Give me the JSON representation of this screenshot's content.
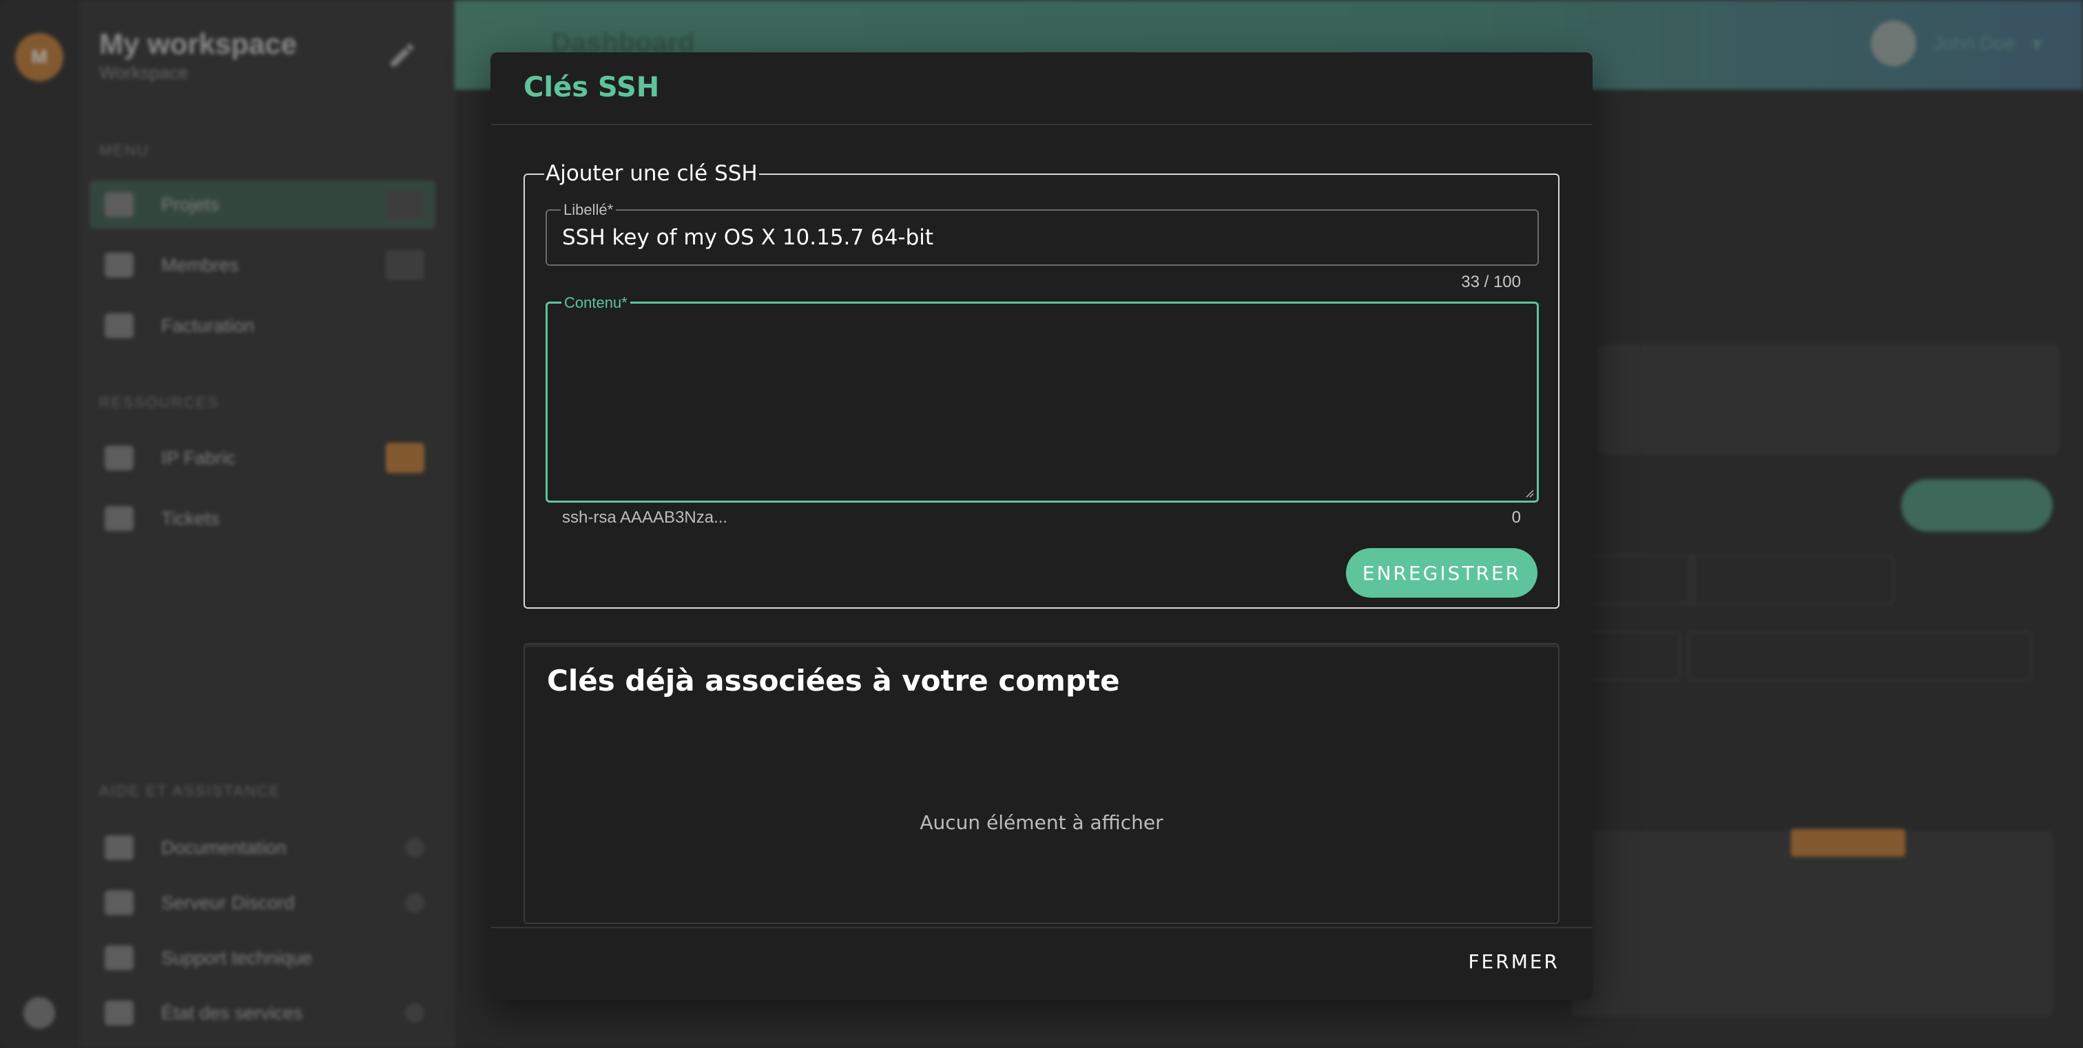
{
  "background": {
    "workspace": {
      "avatar_initials": "M",
      "title": "My workspace",
      "subtitle": "Workspace"
    },
    "sidebar": {
      "sections": [
        "MENU",
        "RESSOURCES",
        "AIDE ET ASSISTANCE"
      ],
      "items": [
        {
          "label": "Projets",
          "icon": "folder-icon"
        },
        {
          "label": "Membres",
          "icon": "team-icon"
        },
        {
          "label": "Facturation",
          "icon": "invoice-icon"
        },
        {
          "label": "IP Fabric",
          "icon": "globe-icon"
        },
        {
          "label": "Tickets",
          "icon": "list-icon"
        },
        {
          "label": "Documentation",
          "icon": "doc-icon"
        },
        {
          "label": "Serveur Discord",
          "icon": "chat-icon"
        },
        {
          "label": "Support technique",
          "icon": "support-icon"
        },
        {
          "label": "État des services",
          "icon": "status-icon"
        }
      ]
    },
    "topbar": {
      "title": "Dashboard",
      "user": "John Doe"
    }
  },
  "dialog": {
    "title": "Clés SSH",
    "form": {
      "legend": "Ajouter une clé SSH",
      "label_field": {
        "label": "Libellé*",
        "value": "SSH key of my OS X 10.15.7 64-bit",
        "counter": "33 / 100"
      },
      "content_field": {
        "label": "Contenu*",
        "value": "",
        "hint": "ssh-rsa AAAAB3Nza...",
        "counter": "0"
      },
      "save_label": "ENREGISTRER"
    },
    "keys": {
      "title": "Clés déjà associées à votre compte",
      "empty_message": "Aucun élément à afficher"
    },
    "close_label": "FERMER"
  },
  "colors": {
    "accent": "#5ec49b",
    "dialog_bg": "#1f1f1f",
    "text": "#ffffff"
  }
}
